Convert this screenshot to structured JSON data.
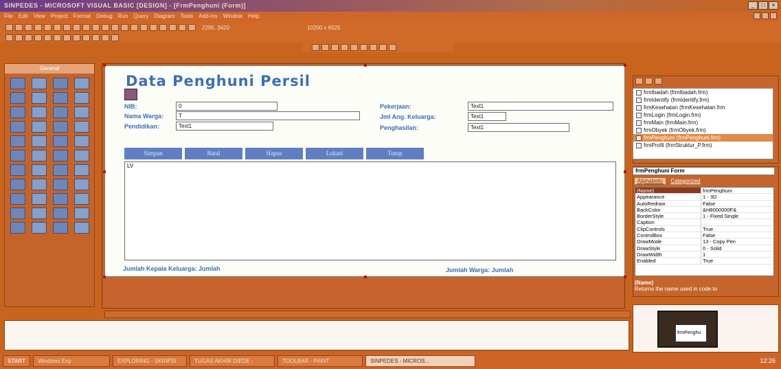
{
  "window": {
    "title": "SINPEDES - MICROSOFT VISUAL BASIC [DESIGN] - [FrmPenghuni (Form)]"
  },
  "menu": [
    "File",
    "Edit",
    "View",
    "Project",
    "Format",
    "Debug",
    "Run",
    "Query",
    "Diagram",
    "Tools",
    "Add-Ins",
    "Window",
    "Help"
  ],
  "toolbar": {
    "position": "2295, 3420",
    "size": "10200 x 6525"
  },
  "toolbox": {
    "title": "General"
  },
  "form": {
    "title": "Data Penghuni Persil",
    "fields": {
      "nib_label": "NIB:",
      "nib_value": "0",
      "nama_label": "Nama Warga:",
      "nama_value": "T",
      "pendidikan_label": "Pendidikan:",
      "pendidikan_value": "Text1",
      "pekerjaan_label": "Pekerjaan:",
      "pekerjaan_value": "Text1",
      "jml_label": "Jml Ang. Keluarga:",
      "jml_value": "Text1",
      "penghasilan_label": "Penghasilan:",
      "penghasilan_value": "Text1"
    },
    "buttons": [
      "Simpan",
      "Batal",
      "Hapus",
      "Lokasi",
      "Tutup"
    ],
    "listview": "LV",
    "footer_left": "Jumlah Kepala Keluarga: Jumlah",
    "footer_right": "Jumlah Warga: Jumlah"
  },
  "project": {
    "items": [
      "frmIbadah (frmIbadah.frm)",
      "frmIdentify (frmIdentify.frm)",
      "frmKesehatan (frmKesehatan.frm",
      "frmLogin (frmLogin.frm)",
      "frmMain (frmMain.frm)",
      "frmObyek (frmObyek.frm)",
      "frmPenghuni (frmPenghuni.frm)",
      "frmProfil (frmStruktur_P.frm)"
    ],
    "selected_index": 6
  },
  "properties": {
    "object": "frmPenghuni Form",
    "tab_alphabetic": "Alphabetic",
    "tab_categorized": "Categorized",
    "rows": [
      {
        "k": "(Name)",
        "v": "frmPenghuni"
      },
      {
        "k": "Appearance",
        "v": "1 - 3D"
      },
      {
        "k": "AutoRedraw",
        "v": "False"
      },
      {
        "k": "BackColor",
        "v": "&H8000000F&"
      },
      {
        "k": "BorderStyle",
        "v": "1 - Fixed Single"
      },
      {
        "k": "Caption",
        "v": ""
      },
      {
        "k": "ClipControls",
        "v": "True"
      },
      {
        "k": "ControlBox",
        "v": "False"
      },
      {
        "k": "DrawMode",
        "v": "13 - Copy Pen"
      },
      {
        "k": "DrawStyle",
        "v": "0 - Solid"
      },
      {
        "k": "DrawWidth",
        "v": "1"
      },
      {
        "k": "Enabled",
        "v": "True"
      }
    ],
    "desc_title": "(Name)",
    "desc_text": "Returns the name used in code to"
  },
  "layout": {
    "form_label": "frmPenghu"
  },
  "taskbar": {
    "start": "START",
    "tasks": [
      "Windows Exp",
      "EXPLORING - SKRIPSI",
      "TUGAS AKHIR DIEDE -",
      "TOOLBAR - PAINT",
      "SINPEDES - MICROS..."
    ],
    "clock": "12:26"
  }
}
